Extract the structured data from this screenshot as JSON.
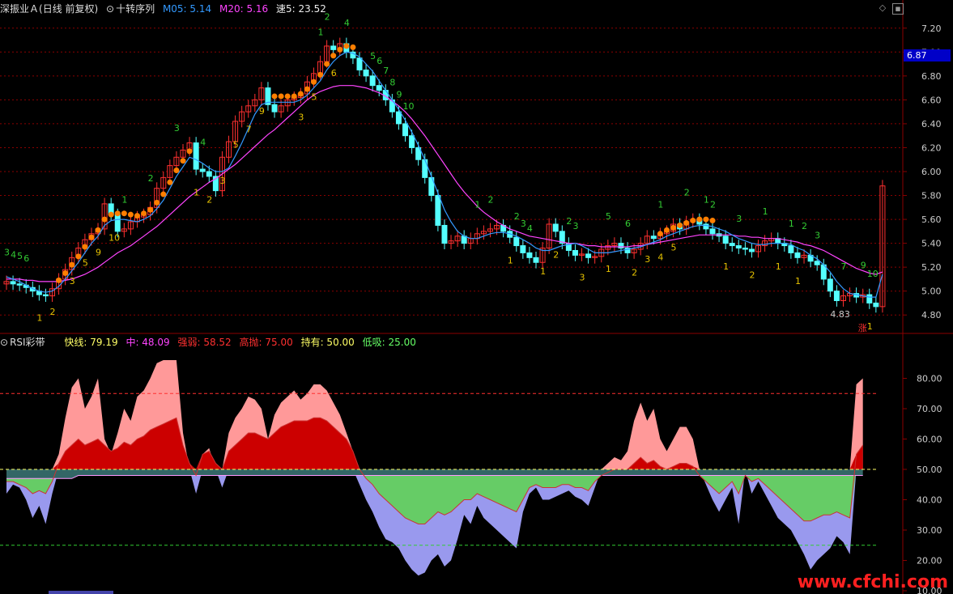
{
  "top_header": {
    "stock": "深振业Ａ",
    "mode": "(日线 前复权)",
    "indicator_name": "十转序列",
    "ma5_label": "M05: 5.14",
    "ma20_label": "M20: 5.16",
    "speed_label": "速5: 23.52"
  },
  "bottom_header": {
    "name": "RSI彩带",
    "fast": "快线: 79.19",
    "mid": "中: 48.09",
    "strong": "强弱: 58.52",
    "high": "高抛: 75.00",
    "hold": "持有: 50.00",
    "low": "低吸: 25.00"
  },
  "price_tag": "6.87",
  "watermark": "www.cfchi.com",
  "annotations": {
    "low_price": "4.83",
    "rise_mark": "涨"
  },
  "colors": {
    "bg": "#000000",
    "grid": "#8b0000",
    "up": "#ff3030",
    "down": "#54ffff",
    "ma5": "#3399ff",
    "ma20": "#ff44ff",
    "orange": "#ff7f00",
    "rsi_pink": "#ff9999",
    "rsi_red": "#cc0000",
    "rsi_green": "#66cc66",
    "rsi_purple": "#9999ee",
    "rsi_teal": "#336666"
  },
  "chart_data": [
    {
      "type": "candlestick",
      "title": "十转序列",
      "yticks": [
        "7.20",
        "7.00",
        "6.80",
        "6.60",
        "6.40",
        "6.20",
        "6.00",
        "5.80",
        "5.60",
        "5.40",
        "5.20",
        "5.00",
        "4.80"
      ],
      "ylim": [
        4.7,
        7.3
      ],
      "close": [
        5.08,
        5.06,
        5.05,
        5.03,
        5.0,
        4.97,
        4.96,
        5.02,
        5.1,
        5.18,
        5.28,
        5.36,
        5.43,
        5.48,
        5.52,
        5.73,
        5.64,
        5.5,
        5.52,
        5.58,
        5.62,
        5.64,
        5.7,
        5.86,
        5.95,
        6.05,
        6.12,
        6.18,
        6.24,
        6.02,
        6.0,
        5.96,
        5.84,
        6.12,
        6.25,
        6.42,
        6.5,
        6.55,
        6.6,
        6.7,
        6.56,
        6.5,
        6.55,
        6.6,
        6.62,
        6.65,
        6.75,
        6.82,
        6.92,
        7.05,
        7.02,
        7.07,
        7.0,
        6.95,
        6.85,
        6.8,
        6.72,
        6.68,
        6.6,
        6.5,
        6.4,
        6.3,
        6.2,
        6.1,
        5.95,
        5.8,
        5.55,
        5.4,
        5.42,
        5.46,
        5.4,
        5.44,
        5.48,
        5.5,
        5.52,
        5.55,
        5.5,
        5.45,
        5.38,
        5.32,
        5.28,
        5.24,
        5.36,
        5.56,
        5.5,
        5.4,
        5.34,
        5.3,
        5.31,
        5.28,
        5.29,
        5.35,
        5.38,
        5.4,
        5.36,
        5.32,
        5.35,
        5.4,
        5.46,
        5.44,
        5.48,
        5.5,
        5.56,
        5.52,
        5.58,
        5.6,
        5.56,
        5.52,
        5.48,
        5.46,
        5.4,
        5.38,
        5.36,
        5.35,
        5.33,
        5.38,
        5.42,
        5.44,
        5.4,
        5.38,
        5.32,
        5.28,
        5.3,
        5.25,
        5.22,
        5.1,
        5.0,
        4.92,
        4.96,
        4.98,
        4.95,
        4.97,
        4.9,
        4.87,
        5.88
      ],
      "ma5": [
        5.12,
        5.1,
        5.08,
        5.05,
        5.02,
        5.0,
        4.99,
        5.0,
        5.04,
        5.1,
        5.17,
        5.24,
        5.32,
        5.4,
        5.46,
        5.55,
        5.59,
        5.6,
        5.6,
        5.59,
        5.58,
        5.6,
        5.63,
        5.69,
        5.76,
        5.86,
        5.96,
        6.04,
        6.12,
        6.1,
        6.07,
        6.03,
        6.0,
        6.0,
        6.03,
        6.13,
        6.24,
        6.36,
        6.48,
        6.56,
        6.58,
        6.58,
        6.58,
        6.58,
        6.58,
        6.6,
        6.64,
        6.7,
        6.76,
        6.85,
        6.92,
        6.97,
        7.0,
        6.99,
        6.96,
        6.9,
        6.84,
        6.76,
        6.68,
        6.6,
        6.52,
        6.43,
        6.33,
        6.22,
        6.1,
        5.96,
        5.82,
        5.68,
        5.58,
        5.5,
        5.46,
        5.44,
        5.44,
        5.46,
        5.48,
        5.49,
        5.49,
        5.48,
        5.46,
        5.43,
        5.4,
        5.36,
        5.34,
        5.34,
        5.36,
        5.38,
        5.39,
        5.4,
        5.38,
        5.35,
        5.32,
        5.32,
        5.32,
        5.33,
        5.34,
        5.35,
        5.36,
        5.37,
        5.39,
        5.41,
        5.43,
        5.46,
        5.48,
        5.5,
        5.52,
        5.54,
        5.55,
        5.55,
        5.54,
        5.52,
        5.5,
        5.47,
        5.44,
        5.42,
        5.4,
        5.39,
        5.39,
        5.4,
        5.4,
        5.4,
        5.39,
        5.36,
        5.34,
        5.3,
        5.27,
        5.22,
        5.16,
        5.08,
        5.02,
        4.98,
        4.97,
        4.96,
        4.95,
        4.95,
        5.14
      ],
      "ma20": [
        5.1,
        5.1,
        5.1,
        5.09,
        5.09,
        5.08,
        5.08,
        5.08,
        5.08,
        5.09,
        5.1,
        5.12,
        5.14,
        5.17,
        5.2,
        5.24,
        5.28,
        5.32,
        5.35,
        5.38,
        5.42,
        5.46,
        5.5,
        5.54,
        5.59,
        5.64,
        5.69,
        5.74,
        5.79,
        5.83,
        5.87,
        5.91,
        5.94,
        5.98,
        6.02,
        6.06,
        6.11,
        6.16,
        6.21,
        6.26,
        6.31,
        6.35,
        6.4,
        6.45,
        6.5,
        6.55,
        6.6,
        6.64,
        6.67,
        6.69,
        6.71,
        6.72,
        6.72,
        6.72,
        6.71,
        6.7,
        6.68,
        6.66,
        6.63,
        6.59,
        6.55,
        6.5,
        6.44,
        6.37,
        6.3,
        6.22,
        6.14,
        6.06,
        5.98,
        5.9,
        5.83,
        5.77,
        5.71,
        5.66,
        5.62,
        5.58,
        5.55,
        5.52,
        5.5,
        5.48,
        5.46,
        5.45,
        5.44,
        5.43,
        5.42,
        5.41,
        5.4,
        5.4,
        5.39,
        5.38,
        5.38,
        5.37,
        5.37,
        5.37,
        5.37,
        5.37,
        5.38,
        5.38,
        5.39,
        5.4,
        5.41,
        5.42,
        5.43,
        5.44,
        5.45,
        5.46,
        5.47,
        5.47,
        5.47,
        5.47,
        5.47,
        5.47,
        5.46,
        5.46,
        5.45,
        5.45,
        5.44,
        5.44,
        5.44,
        5.43,
        5.42,
        5.41,
        5.39,
        5.38,
        5.36,
        5.34,
        5.31,
        5.28,
        5.25,
        5.22,
        5.19,
        5.17,
        5.15,
        5.14,
        5.16
      ]
    },
    {
      "type": "area",
      "title": "RSI彩带",
      "yticks": [
        "80.00",
        "70.00",
        "60.00",
        "50.00",
        "40.00",
        "30.00",
        "20.00",
        "10.00"
      ],
      "ylim": [
        10,
        90
      ],
      "lines": {
        "high": 75,
        "hold": 50,
        "low": 25
      },
      "fast": [
        42,
        45,
        44,
        40,
        34,
        38,
        32,
        42,
        55,
        67,
        77,
        80,
        70,
        74,
        80,
        60,
        55,
        62,
        70,
        66,
        74,
        76,
        80,
        85,
        86,
        86,
        86,
        62,
        50,
        42,
        55,
        57,
        50,
        44,
        62,
        67,
        70,
        74,
        73,
        70,
        60,
        68,
        72,
        74,
        76,
        73,
        75,
        78,
        78,
        76,
        72,
        68,
        62,
        56,
        45,
        40,
        36,
        31,
        27,
        26,
        24,
        20,
        17,
        15,
        16,
        20,
        22,
        18,
        20,
        27,
        35,
        32,
        38,
        34,
        32,
        30,
        28,
        26,
        24,
        36,
        42,
        44,
        40,
        40,
        41,
        42,
        43,
        41,
        40,
        38,
        44,
        50,
        52,
        54,
        53,
        56,
        66,
        72,
        66,
        70,
        60,
        56,
        60,
        64,
        64,
        60,
        50,
        45,
        40,
        36,
        40,
        44,
        32,
        50,
        42,
        46,
        42,
        38,
        34,
        32,
        30,
        26,
        22,
        17,
        20,
        22,
        24,
        28,
        26,
        22,
        78,
        80
      ],
      "mid": [
        47,
        47,
        47,
        47,
        47,
        47,
        47,
        47,
        47,
        47,
        47,
        48,
        48,
        48,
        48,
        48,
        48,
        48,
        48,
        48,
        48,
        48,
        48,
        48,
        48,
        48,
        48,
        48,
        48,
        48,
        48,
        48,
        48,
        48,
        48,
        48,
        48,
        48,
        48,
        48,
        48,
        48,
        48,
        48,
        48,
        48,
        48,
        48,
        48,
        48,
        48,
        48,
        48,
        48,
        48,
        48,
        48,
        48,
        48,
        48,
        48,
        48,
        48,
        48,
        48,
        48,
        48,
        48,
        48,
        48,
        48,
        48,
        48,
        48,
        48,
        48,
        48,
        48,
        48,
        48,
        48,
        48,
        48,
        48,
        48,
        48,
        48,
        48,
        48,
        48,
        48,
        48,
        48,
        48,
        48,
        48,
        48,
        48,
        48,
        48,
        48,
        48,
        48,
        48,
        48,
        48,
        48,
        48,
        48,
        48,
        48,
        48,
        48,
        48,
        48,
        48,
        48,
        48,
        48,
        48,
        48,
        48,
        48,
        48,
        48,
        48,
        48,
        48,
        48,
        48,
        48,
        48
      ],
      "strong": [
        46,
        46,
        45,
        44,
        42,
        43,
        42,
        46,
        52,
        56,
        58,
        60,
        58,
        59,
        60,
        58,
        56,
        57,
        59,
        58,
        60,
        61,
        63,
        64,
        65,
        66,
        67,
        58,
        52,
        48,
        55,
        56,
        52,
        50,
        56,
        58,
        60,
        62,
        62,
        61,
        60,
        62,
        64,
        65,
        66,
        66,
        66,
        67,
        67,
        66,
        64,
        62,
        60,
        56,
        50,
        47,
        45,
        42,
        40,
        38,
        36,
        34,
        33,
        32,
        32,
        34,
        36,
        35,
        36,
        38,
        40,
        40,
        42,
        41,
        40,
        39,
        38,
        37,
        36,
        40,
        44,
        45,
        44,
        44,
        44,
        45,
        45,
        44,
        44,
        43,
        46,
        48,
        49,
        50,
        50,
        50,
        52,
        54,
        52,
        53,
        51,
        50,
        51,
        52,
        52,
        51,
        48,
        46,
        44,
        42,
        44,
        46,
        42,
        48,
        46,
        47,
        45,
        43,
        41,
        39,
        37,
        35,
        33,
        33,
        34,
        35,
        35,
        36,
        35,
        34,
        55,
        58
      ]
    }
  ]
}
